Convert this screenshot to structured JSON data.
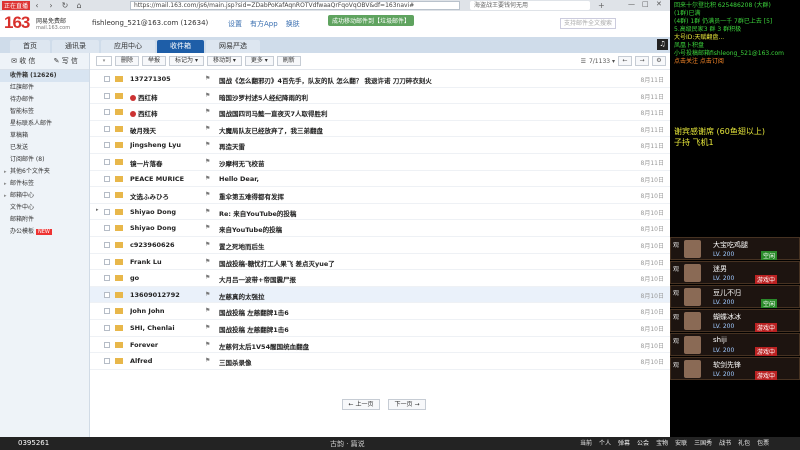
{
  "browser": {
    "rec_badge": "正在直播",
    "url": "https://mail.163.com/js6/main.jsp?sid=ZDabPoKafAqnROTVdfwaaQrFqoVqOBV&df=163navi#",
    "tab_label": "海盗战王要钱何无用",
    "back": "‹",
    "forward": "›",
    "refresh": "↻",
    "home": "⌂",
    "new_tab": "+",
    "minimize": "—",
    "maximize": "□",
    "close": "✕"
  },
  "mail": {
    "logo": "163",
    "logo_sub1": "网易免费邮",
    "logo_sub2": "mail.163.com",
    "user_address": "fishleong_521@163.com (12634)",
    "top_links": [
      "设置",
      "有方App",
      "换肤"
    ],
    "notice": "成功移动邮件到【垃圾邮件】",
    "search_placeholder": "支持邮件全文搜索",
    "tabs": [
      "首页",
      "通讯录",
      "应用中心",
      "收件箱",
      "网易严选"
    ],
    "active_tab": 3,
    "compose_label": "收 信",
    "write_label": "写 信",
    "nav": [
      {
        "label": "收件箱 (12626)",
        "active": true,
        "arrow": false,
        "badge": ""
      },
      {
        "label": "红旗邮件",
        "active": false,
        "arrow": false,
        "badge": ""
      },
      {
        "label": "待办邮件",
        "active": false,
        "arrow": false,
        "badge": ""
      },
      {
        "label": "智能标签",
        "active": false,
        "arrow": false,
        "badge": ""
      },
      {
        "label": "星标联系人邮件",
        "active": false,
        "arrow": false,
        "badge": ""
      },
      {
        "label": "草稿箱",
        "active": false,
        "arrow": false,
        "badge": ""
      },
      {
        "label": "已发送",
        "active": false,
        "arrow": false,
        "badge": ""
      },
      {
        "label": "订阅邮件 (8)",
        "active": false,
        "arrow": false,
        "badge": ""
      },
      {
        "label": "其他6个文件夹",
        "active": false,
        "arrow": true,
        "badge": ""
      },
      {
        "label": "邮件标签",
        "active": false,
        "arrow": true,
        "badge": ""
      },
      {
        "label": "邮箱中心",
        "active": false,
        "arrow": true,
        "badge": ""
      },
      {
        "label": "文件中心",
        "active": false,
        "arrow": false,
        "badge": ""
      },
      {
        "label": "邮箱附件",
        "active": false,
        "arrow": false,
        "badge": ""
      },
      {
        "label": "办公模板",
        "active": false,
        "arrow": false,
        "badge": "NEW"
      }
    ],
    "toolbar": {
      "select_all": "▾",
      "buttons": [
        "删除",
        "举报",
        "标记为 ▾",
        "移动到 ▾",
        "更多 ▾",
        "刷新"
      ],
      "page_info": "7/1133 ▾",
      "prev": "←",
      "next": "→",
      "settings": "⚙"
    },
    "rows": [
      {
        "sender": "137271305",
        "subject": "国战《怎么翻邪刃》4百先手，队友的队 怎么翻？ 我退许诺 刀刀碎衣刻火",
        "date": "8月11日",
        "dot": false,
        "expander": false,
        "hover": false
      },
      {
        "sender": "西红柿",
        "subject": "暗国沙罗村述5人经纪降雨的利",
        "date": "8月11日",
        "dot": true,
        "expander": false,
        "hover": false
      },
      {
        "sender": "西红柿",
        "subject": "国战国四司马懿一直夜灭7人取得胜利",
        "date": "8月11日",
        "dot": true,
        "expander": false,
        "hover": false
      },
      {
        "sender": "破月残天",
        "subject": "大魔局队友已经放弃了，我三弟翻盘",
        "date": "8月11日",
        "dot": false,
        "expander": false,
        "hover": false
      },
      {
        "sender": "Jingsheng Lyu",
        "subject": "再造天雷",
        "date": "8月11日",
        "dot": false,
        "expander": false,
        "hover": false
      },
      {
        "sender": "镜一片落春",
        "subject": "沙摩柯无飞校苗",
        "date": "8月11日",
        "dot": false,
        "expander": false,
        "hover": false
      },
      {
        "sender": "PEACE MURICE",
        "subject": "Hello Dear,",
        "date": "8月10日",
        "dot": false,
        "expander": false,
        "hover": false
      },
      {
        "sender": "文选ふみひろ",
        "subject": "重伞第五难得都有发挥",
        "date": "8月10日",
        "dot": false,
        "expander": false,
        "hover": false
      },
      {
        "sender": "Shiyao Dong",
        "subject": "Re: 来自YouTube的投稿",
        "date": "8月10日",
        "dot": false,
        "expander": true,
        "hover": false
      },
      {
        "sender": "Shiyao Dong",
        "subject": "来自YouTube的投稿",
        "date": "8月10日",
        "dot": false,
        "expander": false,
        "hover": false
      },
      {
        "sender": "c923960626",
        "subject": "置之死地而后生",
        "date": "8月10日",
        "dot": false,
        "expander": false,
        "hover": false
      },
      {
        "sender": "Frank Lu",
        "subject": "国战投稿-糖忧打工人果飞 差点灭yue了",
        "date": "8月10日",
        "dot": false,
        "expander": false,
        "hover": false
      },
      {
        "sender": "go",
        "subject": "大月吕一波带+帝国震尸报",
        "date": "8月10日",
        "dot": false,
        "expander": false,
        "hover": false
      },
      {
        "sender": "13609012792",
        "subject": "左慈真的太强拉",
        "date": "8月10日",
        "dot": false,
        "expander": false,
        "hover": true
      },
      {
        "sender": "John John",
        "subject": "国战投稿 左慈翻牌1击6",
        "date": "8月10日",
        "dot": false,
        "expander": false,
        "hover": false
      },
      {
        "sender": "SHI, Chenlai",
        "subject": "国战投稿 左慈翻牌1击6",
        "date": "8月10日",
        "dot": false,
        "expander": false,
        "hover": false
      },
      {
        "sender": "Forever",
        "subject": "左慈何太后1V54醒国统血翻盘",
        "date": "8月10日",
        "dot": false,
        "expander": false,
        "hover": false
      },
      {
        "sender": "Alfred",
        "subject": "三国杀录像",
        "date": "8月10日",
        "dot": false,
        "expander": false,
        "hover": false
      }
    ],
    "bottom_prev": "← 上一页",
    "bottom_next": "下一页 →"
  },
  "taskbar": {
    "left_text": "0395261",
    "middle_text": "古韵 · 篇说",
    "items": [
      "当前",
      "个人",
      "弹幕",
      "公会",
      "宝物",
      "安联",
      "三国秀",
      "战书",
      "礼包",
      "包票"
    ]
  },
  "stream": {
    "chat": [
      {
        "text": "回来十尔登比积 625486208 (大群)",
        "color": "green"
      },
      {
        "text": "(1群)已满",
        "color": "green"
      },
      {
        "text": "(4群) 1群 仍满员一千 7群已上去 [5]",
        "color": "green"
      },
      {
        "text": "5.高级民家3 群 3 群积极",
        "color": "green"
      },
      {
        "text": "大号ID:天赋翻盘...",
        "color": "yellow"
      },
      {
        "text": "凤凰卜积盘",
        "color": "green"
      },
      {
        "text": "小号投稿邮箱fishleong_521@163.com",
        "color": "green"
      },
      {
        "text": "点击关注 点击订阅",
        "color": "orange"
      },
      {
        "text": "谢宾感谢席 (60鱼翅以上)",
        "color": "yellow"
      },
      {
        "text": "子持 飞机1",
        "color": "yellow"
      }
    ],
    "players": [
      {
        "flag": "观",
        "name": "大宝吃鸡腿",
        "level": "LV. 200",
        "status": "空闲",
        "state": "green"
      },
      {
        "flag": "观",
        "name": "迷男",
        "level": "LV. 200",
        "status": "游戏中",
        "state": "red"
      },
      {
        "flag": "观",
        "name": "豆儿不归",
        "level": "LV. 200",
        "status": "空闲",
        "state": "green"
      },
      {
        "flag": "观",
        "name": "蝴蝶冰冰",
        "level": "LV. 200",
        "status": "游戏中",
        "state": "red"
      },
      {
        "flag": "观",
        "name": "shiji",
        "level": "LV. 200",
        "status": "游戏中",
        "state": "red"
      },
      {
        "flag": "观",
        "name": "软剑先锋",
        "level": "LV. 200",
        "status": "游戏中",
        "state": "red"
      }
    ]
  }
}
